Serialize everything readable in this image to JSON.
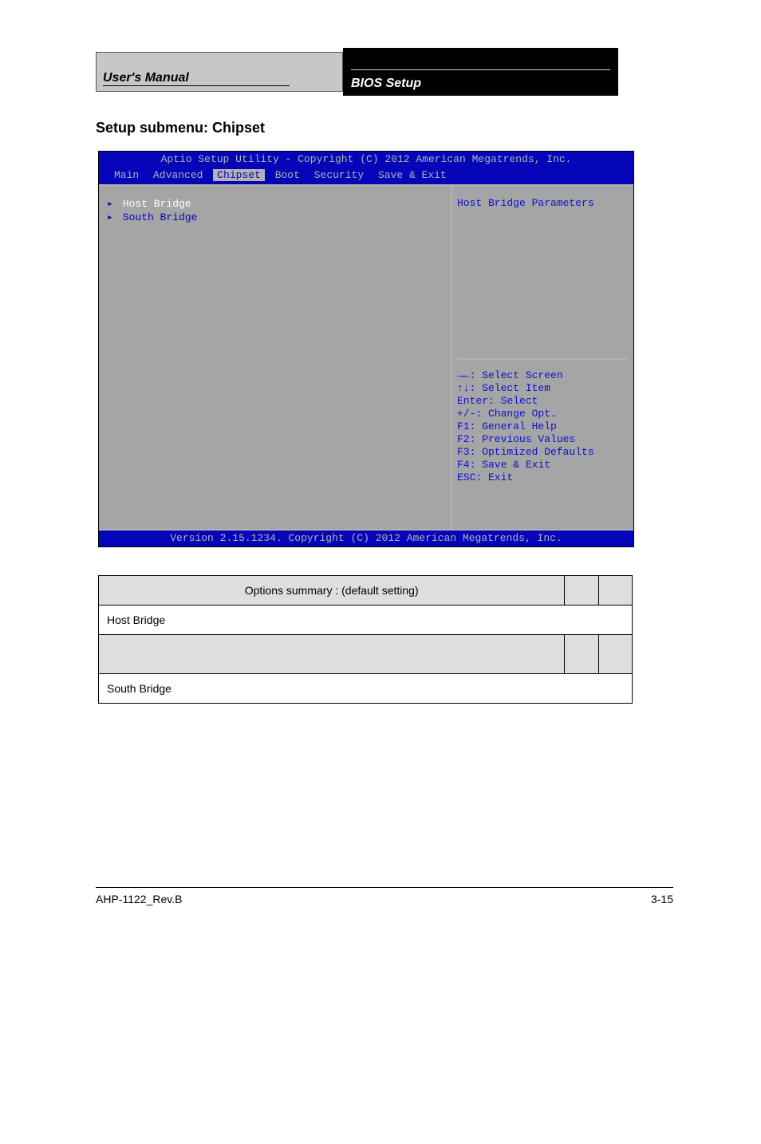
{
  "header": {
    "left_title": "User's Manual",
    "right_title": "BIOS Setup"
  },
  "section_title": "Setup submenu: Chipset",
  "bios": {
    "top_title": "Aptio Setup Utility - Copyright (C) 2012 American Megatrends, Inc.",
    "tabs": {
      "items": [
        "Main",
        "Advanced",
        "Chipset",
        "Boot",
        "Security",
        "Save & Exit"
      ],
      "active_index": 2
    },
    "left_items": [
      {
        "label": "Host Bridge",
        "selected": true
      },
      {
        "label": "South Bridge",
        "selected": false
      }
    ],
    "help_top": "Host Bridge Parameters",
    "help_bottom": [
      "→←: Select Screen",
      "↑↓: Select Item",
      "Enter: Select",
      "+/-: Change Opt.",
      "F1: General Help",
      "F2: Previous Values",
      "F3: Optimized Defaults",
      "F4: Save & Exit",
      "ESC: Exit"
    ],
    "footer": "Version 2.15.1234. Copyright (C) 2012 American Megatrends, Inc."
  },
  "table": {
    "rows": [
      {
        "type": "header",
        "cells": [
          "Options summary :  (default setting)",
          "",
          ""
        ]
      },
      {
        "type": "label",
        "label": "Host Bridge",
        "span": 3
      },
      {
        "type": "header",
        "cells": [
          "",
          "",
          ""
        ]
      },
      {
        "type": "label",
        "label": "South Bridge",
        "span": 3
      }
    ],
    "headers": [
      "Options summary :  (default setting)"
    ]
  },
  "table_rows": {
    "hdr1_c1": "Options summary :  (default setting)",
    "hdr1_c2": "",
    "hdr1_c3": "",
    "row1_label": "Host Bridge",
    "hdr2_c1": "",
    "hdr2_c2": "",
    "hdr2_c3": "",
    "row2_label": "South Bridge"
  },
  "page_footer": {
    "left": "AHP-1122_Rev.B",
    "right": "3-15"
  }
}
